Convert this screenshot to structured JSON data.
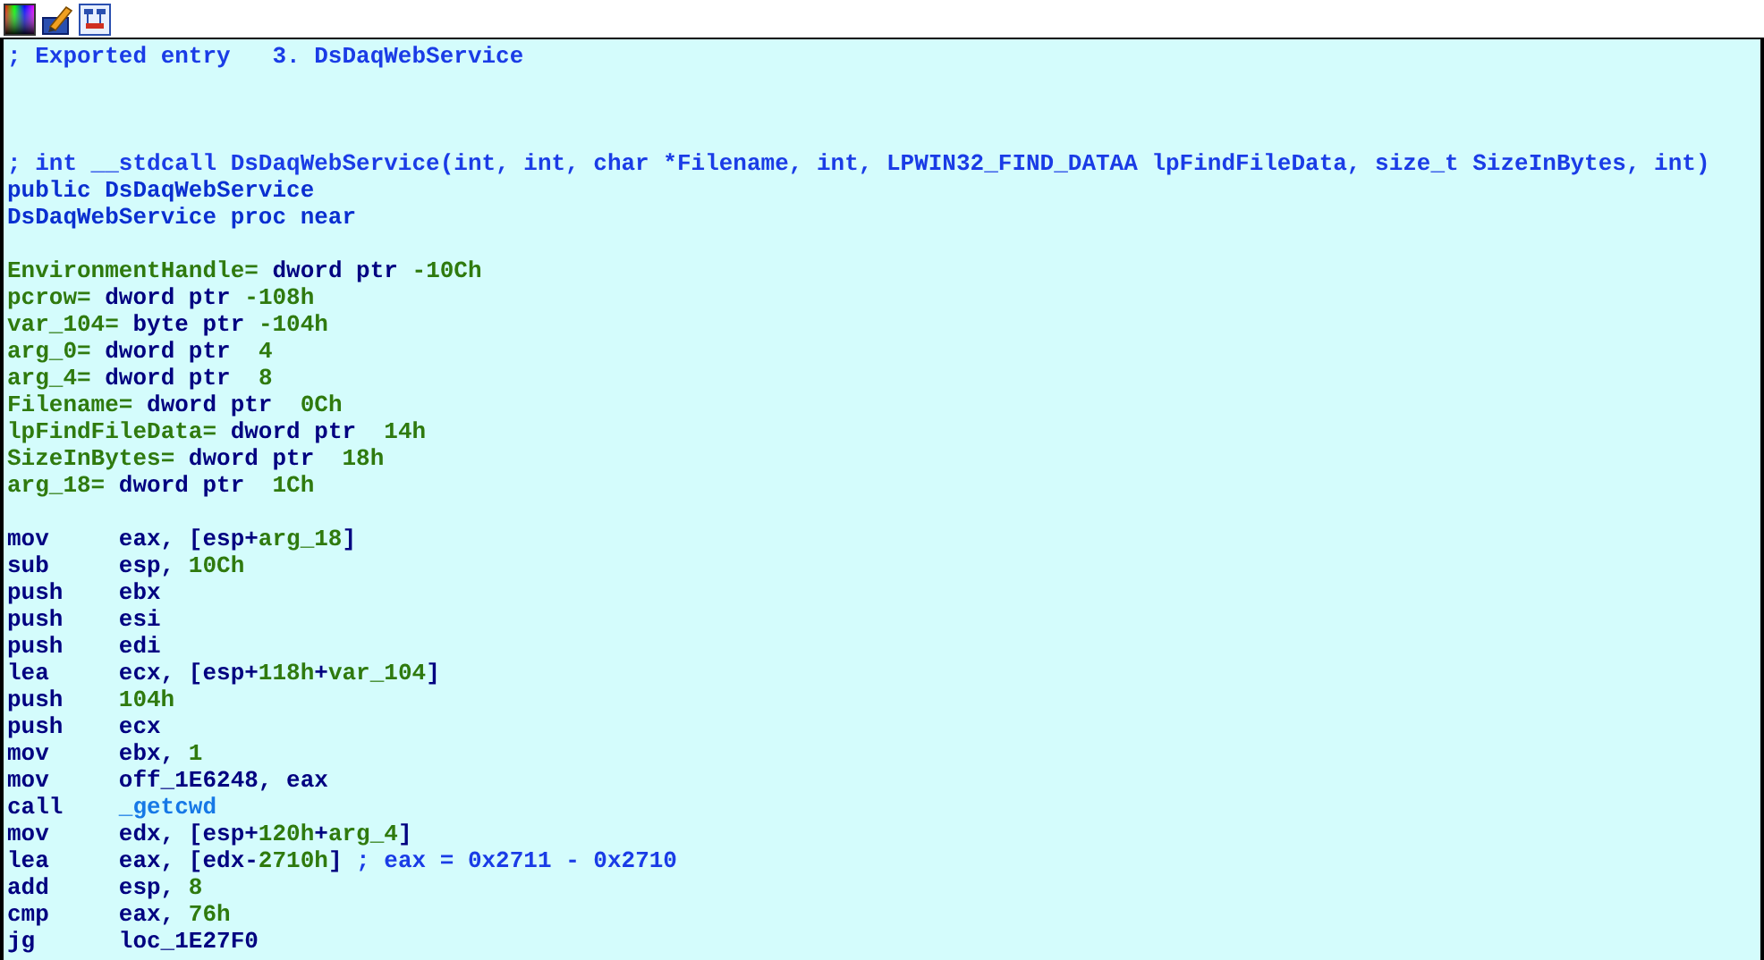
{
  "toolbar": {
    "icons": [
      {
        "kind": "palette"
      },
      {
        "kind": "pencil"
      },
      {
        "kind": "graph"
      }
    ]
  },
  "lines": [
    {
      "kind": "text",
      "segments": [
        {
          "text": "; Exported entry   3. DsDaqWebService",
          "kind": "comment"
        }
      ]
    },
    {
      "kind": "blank"
    },
    {
      "kind": "blank"
    },
    {
      "kind": "blank"
    },
    {
      "kind": "text",
      "segments": [
        {
          "text": "; int __stdcall DsDaqWebService(int, int, char *Filename, int, LPWIN32_FIND_DATAA lpFindFileData, size_t SizeInBytes, int)",
          "kind": "comment"
        }
      ]
    },
    {
      "kind": "text",
      "segments": [
        {
          "text": "public DsDaqWebService",
          "kind": "label"
        }
      ]
    },
    {
      "kind": "text",
      "segments": [
        {
          "text": "DsDaqWebService proc near",
          "kind": "label"
        }
      ]
    },
    {
      "kind": "blank"
    },
    {
      "kind": "text",
      "segments": [
        {
          "text": "EnvironmentHandle=",
          "kind": "name"
        },
        {
          "text": " dword ptr ",
          "kind": "plain"
        },
        {
          "text": "-10Ch",
          "kind": "number"
        }
      ]
    },
    {
      "kind": "text",
      "segments": [
        {
          "text": "pcrow=",
          "kind": "name"
        },
        {
          "text": " dword ptr ",
          "kind": "plain"
        },
        {
          "text": "-108h",
          "kind": "number"
        }
      ]
    },
    {
      "kind": "text",
      "segments": [
        {
          "text": "var_104=",
          "kind": "name"
        },
        {
          "text": " byte ptr ",
          "kind": "plain"
        },
        {
          "text": "-104h",
          "kind": "number"
        }
      ]
    },
    {
      "kind": "text",
      "segments": [
        {
          "text": "arg_0=",
          "kind": "name"
        },
        {
          "text": " dword ptr  ",
          "kind": "plain"
        },
        {
          "text": "4",
          "kind": "number"
        }
      ]
    },
    {
      "kind": "text",
      "segments": [
        {
          "text": "arg_4=",
          "kind": "name"
        },
        {
          "text": " dword ptr  ",
          "kind": "plain"
        },
        {
          "text": "8",
          "kind": "number"
        }
      ]
    },
    {
      "kind": "text",
      "segments": [
        {
          "text": "Filename=",
          "kind": "name"
        },
        {
          "text": " dword ptr  ",
          "kind": "plain"
        },
        {
          "text": "0Ch",
          "kind": "number"
        }
      ]
    },
    {
      "kind": "text",
      "segments": [
        {
          "text": "lpFindFileData=",
          "kind": "name"
        },
        {
          "text": " dword ptr  ",
          "kind": "plain"
        },
        {
          "text": "14h",
          "kind": "number"
        }
      ]
    },
    {
      "kind": "text",
      "segments": [
        {
          "text": "SizeInBytes=",
          "kind": "name"
        },
        {
          "text": " dword ptr  ",
          "kind": "plain"
        },
        {
          "text": "18h",
          "kind": "number"
        }
      ]
    },
    {
      "kind": "text",
      "segments": [
        {
          "text": "arg_18=",
          "kind": "name"
        },
        {
          "text": " dword ptr  ",
          "kind": "plain"
        },
        {
          "text": "1Ch",
          "kind": "number"
        }
      ]
    },
    {
      "kind": "blank"
    },
    {
      "kind": "instr",
      "mnemonic": "mov",
      "segments": [
        {
          "text": "eax, [esp+",
          "kind": "plain"
        },
        {
          "text": "arg_18",
          "kind": "name"
        },
        {
          "text": "]",
          "kind": "plain"
        }
      ]
    },
    {
      "kind": "instr",
      "mnemonic": "sub",
      "segments": [
        {
          "text": "esp, ",
          "kind": "plain"
        },
        {
          "text": "10Ch",
          "kind": "number"
        }
      ]
    },
    {
      "kind": "instr",
      "mnemonic": "push",
      "segments": [
        {
          "text": "ebx",
          "kind": "plain"
        }
      ]
    },
    {
      "kind": "instr",
      "mnemonic": "push",
      "segments": [
        {
          "text": "esi",
          "kind": "plain"
        }
      ]
    },
    {
      "kind": "instr",
      "mnemonic": "push",
      "segments": [
        {
          "text": "edi",
          "kind": "plain"
        }
      ]
    },
    {
      "kind": "instr",
      "mnemonic": "lea",
      "segments": [
        {
          "text": "ecx, [esp+",
          "kind": "plain"
        },
        {
          "text": "118h",
          "kind": "number"
        },
        {
          "text": "+",
          "kind": "plain"
        },
        {
          "text": "var_104",
          "kind": "name"
        },
        {
          "text": "]",
          "kind": "plain"
        }
      ]
    },
    {
      "kind": "instr",
      "mnemonic": "push",
      "segments": [
        {
          "text": "104h",
          "kind": "number"
        }
      ]
    },
    {
      "kind": "instr",
      "mnemonic": "push",
      "segments": [
        {
          "text": "ecx",
          "kind": "plain"
        }
      ]
    },
    {
      "kind": "instr",
      "mnemonic": "mov",
      "segments": [
        {
          "text": "ebx, ",
          "kind": "plain"
        },
        {
          "text": "1",
          "kind": "number"
        }
      ]
    },
    {
      "kind": "instr",
      "mnemonic": "mov",
      "segments": [
        {
          "text": "off_1E6248, eax",
          "kind": "plain"
        }
      ]
    },
    {
      "kind": "instr",
      "mnemonic": "call",
      "segments": [
        {
          "text": "_getcwd",
          "kind": "ref"
        }
      ]
    },
    {
      "kind": "instr",
      "mnemonic": "mov",
      "segments": [
        {
          "text": "edx, [esp+",
          "kind": "plain"
        },
        {
          "text": "120h",
          "kind": "number"
        },
        {
          "text": "+",
          "kind": "plain"
        },
        {
          "text": "arg_4",
          "kind": "name"
        },
        {
          "text": "]",
          "kind": "plain"
        }
      ]
    },
    {
      "kind": "instr",
      "mnemonic": "lea",
      "segments": [
        {
          "text": "eax, [edx-",
          "kind": "plain"
        },
        {
          "text": "2710h",
          "kind": "number"
        },
        {
          "text": "] ",
          "kind": "plain"
        },
        {
          "text": "; eax = 0x2711 - 0x2710",
          "kind": "comment"
        }
      ]
    },
    {
      "kind": "instr",
      "mnemonic": "add",
      "segments": [
        {
          "text": "esp, ",
          "kind": "plain"
        },
        {
          "text": "8",
          "kind": "number"
        }
      ]
    },
    {
      "kind": "instr",
      "mnemonic": "cmp",
      "segments": [
        {
          "text": "eax, ",
          "kind": "plain"
        },
        {
          "text": "76h",
          "kind": "number"
        }
      ]
    },
    {
      "kind": "instr",
      "mnemonic": "jg",
      "segments": [
        {
          "text": "loc_1E27F0",
          "kind": "plain"
        }
      ]
    }
  ]
}
